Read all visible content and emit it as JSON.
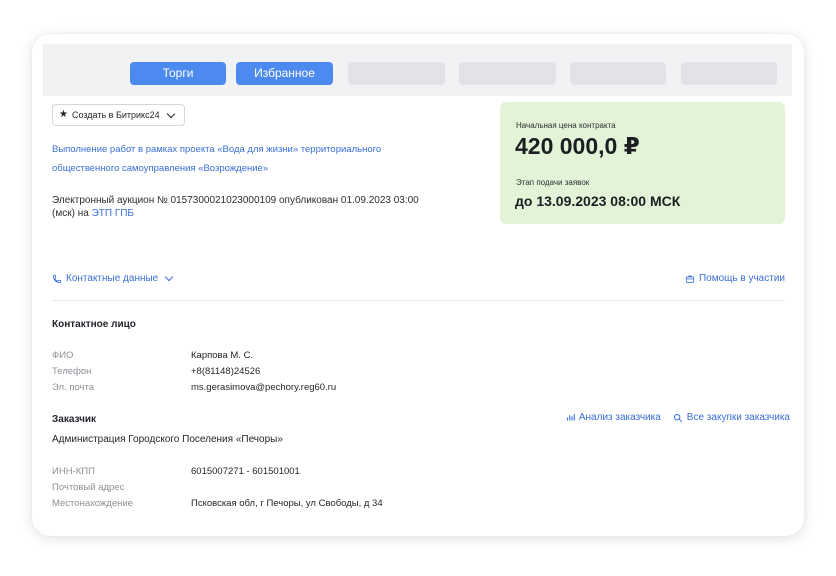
{
  "tabs": [
    {
      "label": "Торги",
      "state": "active"
    },
    {
      "label": "Избранное",
      "state": "active"
    },
    {
      "label": "",
      "state": "placeholder"
    },
    {
      "label": "",
      "state": "placeholder"
    },
    {
      "label": "",
      "state": "placeholder"
    },
    {
      "label": "",
      "state": "placeholder"
    }
  ],
  "bitrix_button": {
    "label": "Создать в Битрикс24",
    "icon": "star-icon"
  },
  "lot": {
    "title": "Выполнение работ в рамках проекта «Вода для жизни» территориального общественного самоуправления «Возрождение»",
    "auction_text": "Электронный аукцион № 0157300021023000109 опубликован 01.09.2023 03:00 (мск) на",
    "platform_link": "ЭТП ГПБ"
  },
  "price_box": {
    "price_label": "Начальная цена контракта",
    "price_value": "420 000,0 ₽",
    "stage_label": "Этап подачи заявок",
    "stage_value": "до 13.09.2023 08:00 МСК",
    "background": "#e3f3d8"
  },
  "contacts_toggle": {
    "label": "Контактные данные",
    "icon": "phone-icon"
  },
  "help_link": {
    "label": "Помощь в участии",
    "icon": "briefcase-icon"
  },
  "contact_person": {
    "title": "Контактное лицо",
    "rows": [
      {
        "label": "ФИО",
        "value": "Карпова М. С."
      },
      {
        "label": "Телефон",
        "value": "+8(81148)24526"
      },
      {
        "label": "Эл. почта",
        "value": "ms.gerasimova@pechory.reg60.ru"
      }
    ]
  },
  "customer": {
    "title": "Заказчик",
    "name": "Администрация Городского Поселения «Печоры»",
    "analysis_link": "Анализ заказчика",
    "purchases_link": "Все закупки заказчика",
    "rows": [
      {
        "label": "ИНН-КПП",
        "value": "6015007271 - 601501001"
      },
      {
        "label": "Почтовый адрес",
        "value": ""
      },
      {
        "label": "Местонахождение",
        "value": "Псковская обл, г Печоры, ул Свободы, д 34"
      }
    ]
  },
  "colors": {
    "accent": "#4d8af0",
    "link": "#3a6fd8",
    "price_bg": "#e3f3d8"
  }
}
